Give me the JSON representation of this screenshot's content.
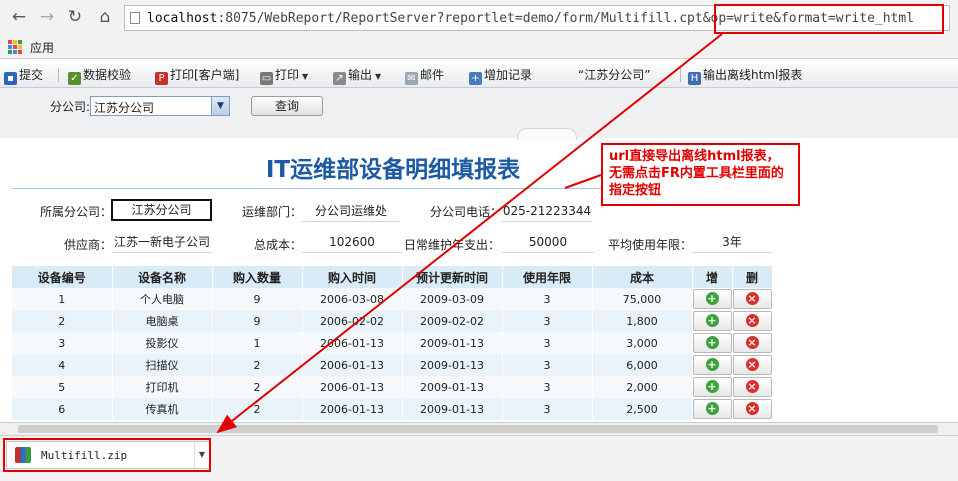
{
  "browser": {
    "url_host": "localhost",
    "url_rest": ":8075/WebReport/ReportServer?reportlet=demo/form/Multifill.cpt&op=write&format=write_html",
    "bookmark_apps": "应用"
  },
  "toolbar": {
    "submit": "提交",
    "validate": "数据校验",
    "print_client": "打印[客户端]",
    "print": "打印",
    "export": "输出",
    "mail": "邮件",
    "add_record": "增加记录",
    "branch_quote": "“江苏分公司”",
    "export_html": "输出离线html报表"
  },
  "params": {
    "branch_label": "分公司:",
    "branch_value": "江苏分公司",
    "query_button": "查询"
  },
  "report": {
    "title": "IT运维部设备明细填报表",
    "fields": {
      "branch_label": "所属分公司：",
      "branch_value": "江苏分公司",
      "dept_label": "运维部门：",
      "dept_value": "分公司运维处",
      "phone_label": "分公司电话：",
      "phone_value": "025-21223344",
      "supplier_label": "供应商：",
      "supplier_value": "江苏一新电子公司",
      "total_cost_label": "总成本：",
      "total_cost_value": "102600",
      "maintenance_label": "日常维护年支出：",
      "maintenance_value": "50000",
      "avg_years_label": "平均使用年限：",
      "avg_years_value": "3年"
    },
    "columns": [
      "设备编号",
      "设备名称",
      "购入数量",
      "购入时间",
      "预计更新时间",
      "使用年限",
      "成本",
      "增",
      "删"
    ],
    "rows": [
      [
        "1",
        "个人电脑",
        "9",
        "2006-03-08",
        "2009-03-09",
        "3",
        "75,000"
      ],
      [
        "2",
        "电脑桌",
        "9",
        "2006-02-02",
        "2009-02-02",
        "3",
        "1,800"
      ],
      [
        "3",
        "投影仪",
        "1",
        "2006-01-13",
        "2009-01-13",
        "3",
        "3,000"
      ],
      [
        "4",
        "扫描仪",
        "2",
        "2006-01-13",
        "2009-01-13",
        "3",
        "6,000"
      ],
      [
        "5",
        "打印机",
        "2",
        "2006-01-13",
        "2009-01-13",
        "3",
        "2,000"
      ],
      [
        "6",
        "传真机",
        "2",
        "2006-01-13",
        "2009-01-13",
        "3",
        "2,500"
      ]
    ]
  },
  "annotation": {
    "callout_text": "url直接导出离线html报表，无需点击FR内置工具栏里面的指定按钮",
    "accent_color": "#e00000"
  },
  "download": {
    "file_name": "Multifill.zip"
  }
}
